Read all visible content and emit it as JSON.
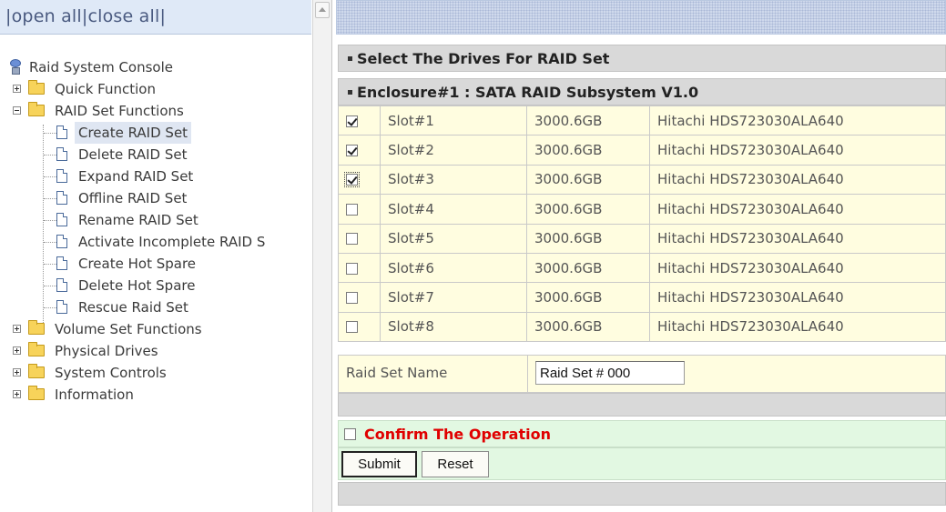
{
  "nav": {
    "open_all": "open all",
    "close_all": "close all",
    "separator": "|",
    "root": "Raid System Console",
    "tree": [
      {
        "label": "Quick Function"
      },
      {
        "label": "RAID Set Functions",
        "children": [
          "Create RAID Set",
          "Delete RAID Set",
          "Expand RAID Set",
          "Offline RAID Set",
          "Rename RAID Set",
          "Activate Incomplete RAID S",
          "Create Hot Spare",
          "Delete Hot Spare",
          "Rescue Raid Set"
        ]
      },
      {
        "label": "Volume Set Functions"
      },
      {
        "label": "Physical Drives"
      },
      {
        "label": "System Controls"
      },
      {
        "label": "Information"
      }
    ],
    "selected": "Create RAID Set"
  },
  "main": {
    "section_title": "Select The Drives For RAID Set",
    "enclosure_title": "Enclosure#1 : SATA RAID Subsystem V1.0",
    "drives": [
      {
        "slot": "Slot#1",
        "capacity": "3000.6GB",
        "model": "Hitachi HDS723030ALA640",
        "checked": true
      },
      {
        "slot": "Slot#2",
        "capacity": "3000.6GB",
        "model": "Hitachi HDS723030ALA640",
        "checked": true
      },
      {
        "slot": "Slot#3",
        "capacity": "3000.6GB",
        "model": "Hitachi HDS723030ALA640",
        "checked": true
      },
      {
        "slot": "Slot#4",
        "capacity": "3000.6GB",
        "model": "Hitachi HDS723030ALA640",
        "checked": false
      },
      {
        "slot": "Slot#5",
        "capacity": "3000.6GB",
        "model": "Hitachi HDS723030ALA640",
        "checked": false
      },
      {
        "slot": "Slot#6",
        "capacity": "3000.6GB",
        "model": "Hitachi HDS723030ALA640",
        "checked": false
      },
      {
        "slot": "Slot#7",
        "capacity": "3000.6GB",
        "model": "Hitachi HDS723030ALA640",
        "checked": false
      },
      {
        "slot": "Slot#8",
        "capacity": "3000.6GB",
        "model": "Hitachi HDS723030ALA640",
        "checked": false
      }
    ],
    "raid_set_name_label": "Raid Set Name",
    "raid_set_name_value": "Raid Set # 000",
    "confirm_label": "Confirm The Operation",
    "confirm_checked": false,
    "submit_label": "Submit",
    "reset_label": "Reset"
  },
  "colors": {
    "row_bg": "#fffde0",
    "confirm_bg": "#e2f8e2",
    "confirm_text": "#e00000",
    "bar_bg": "#d9d9d9"
  }
}
